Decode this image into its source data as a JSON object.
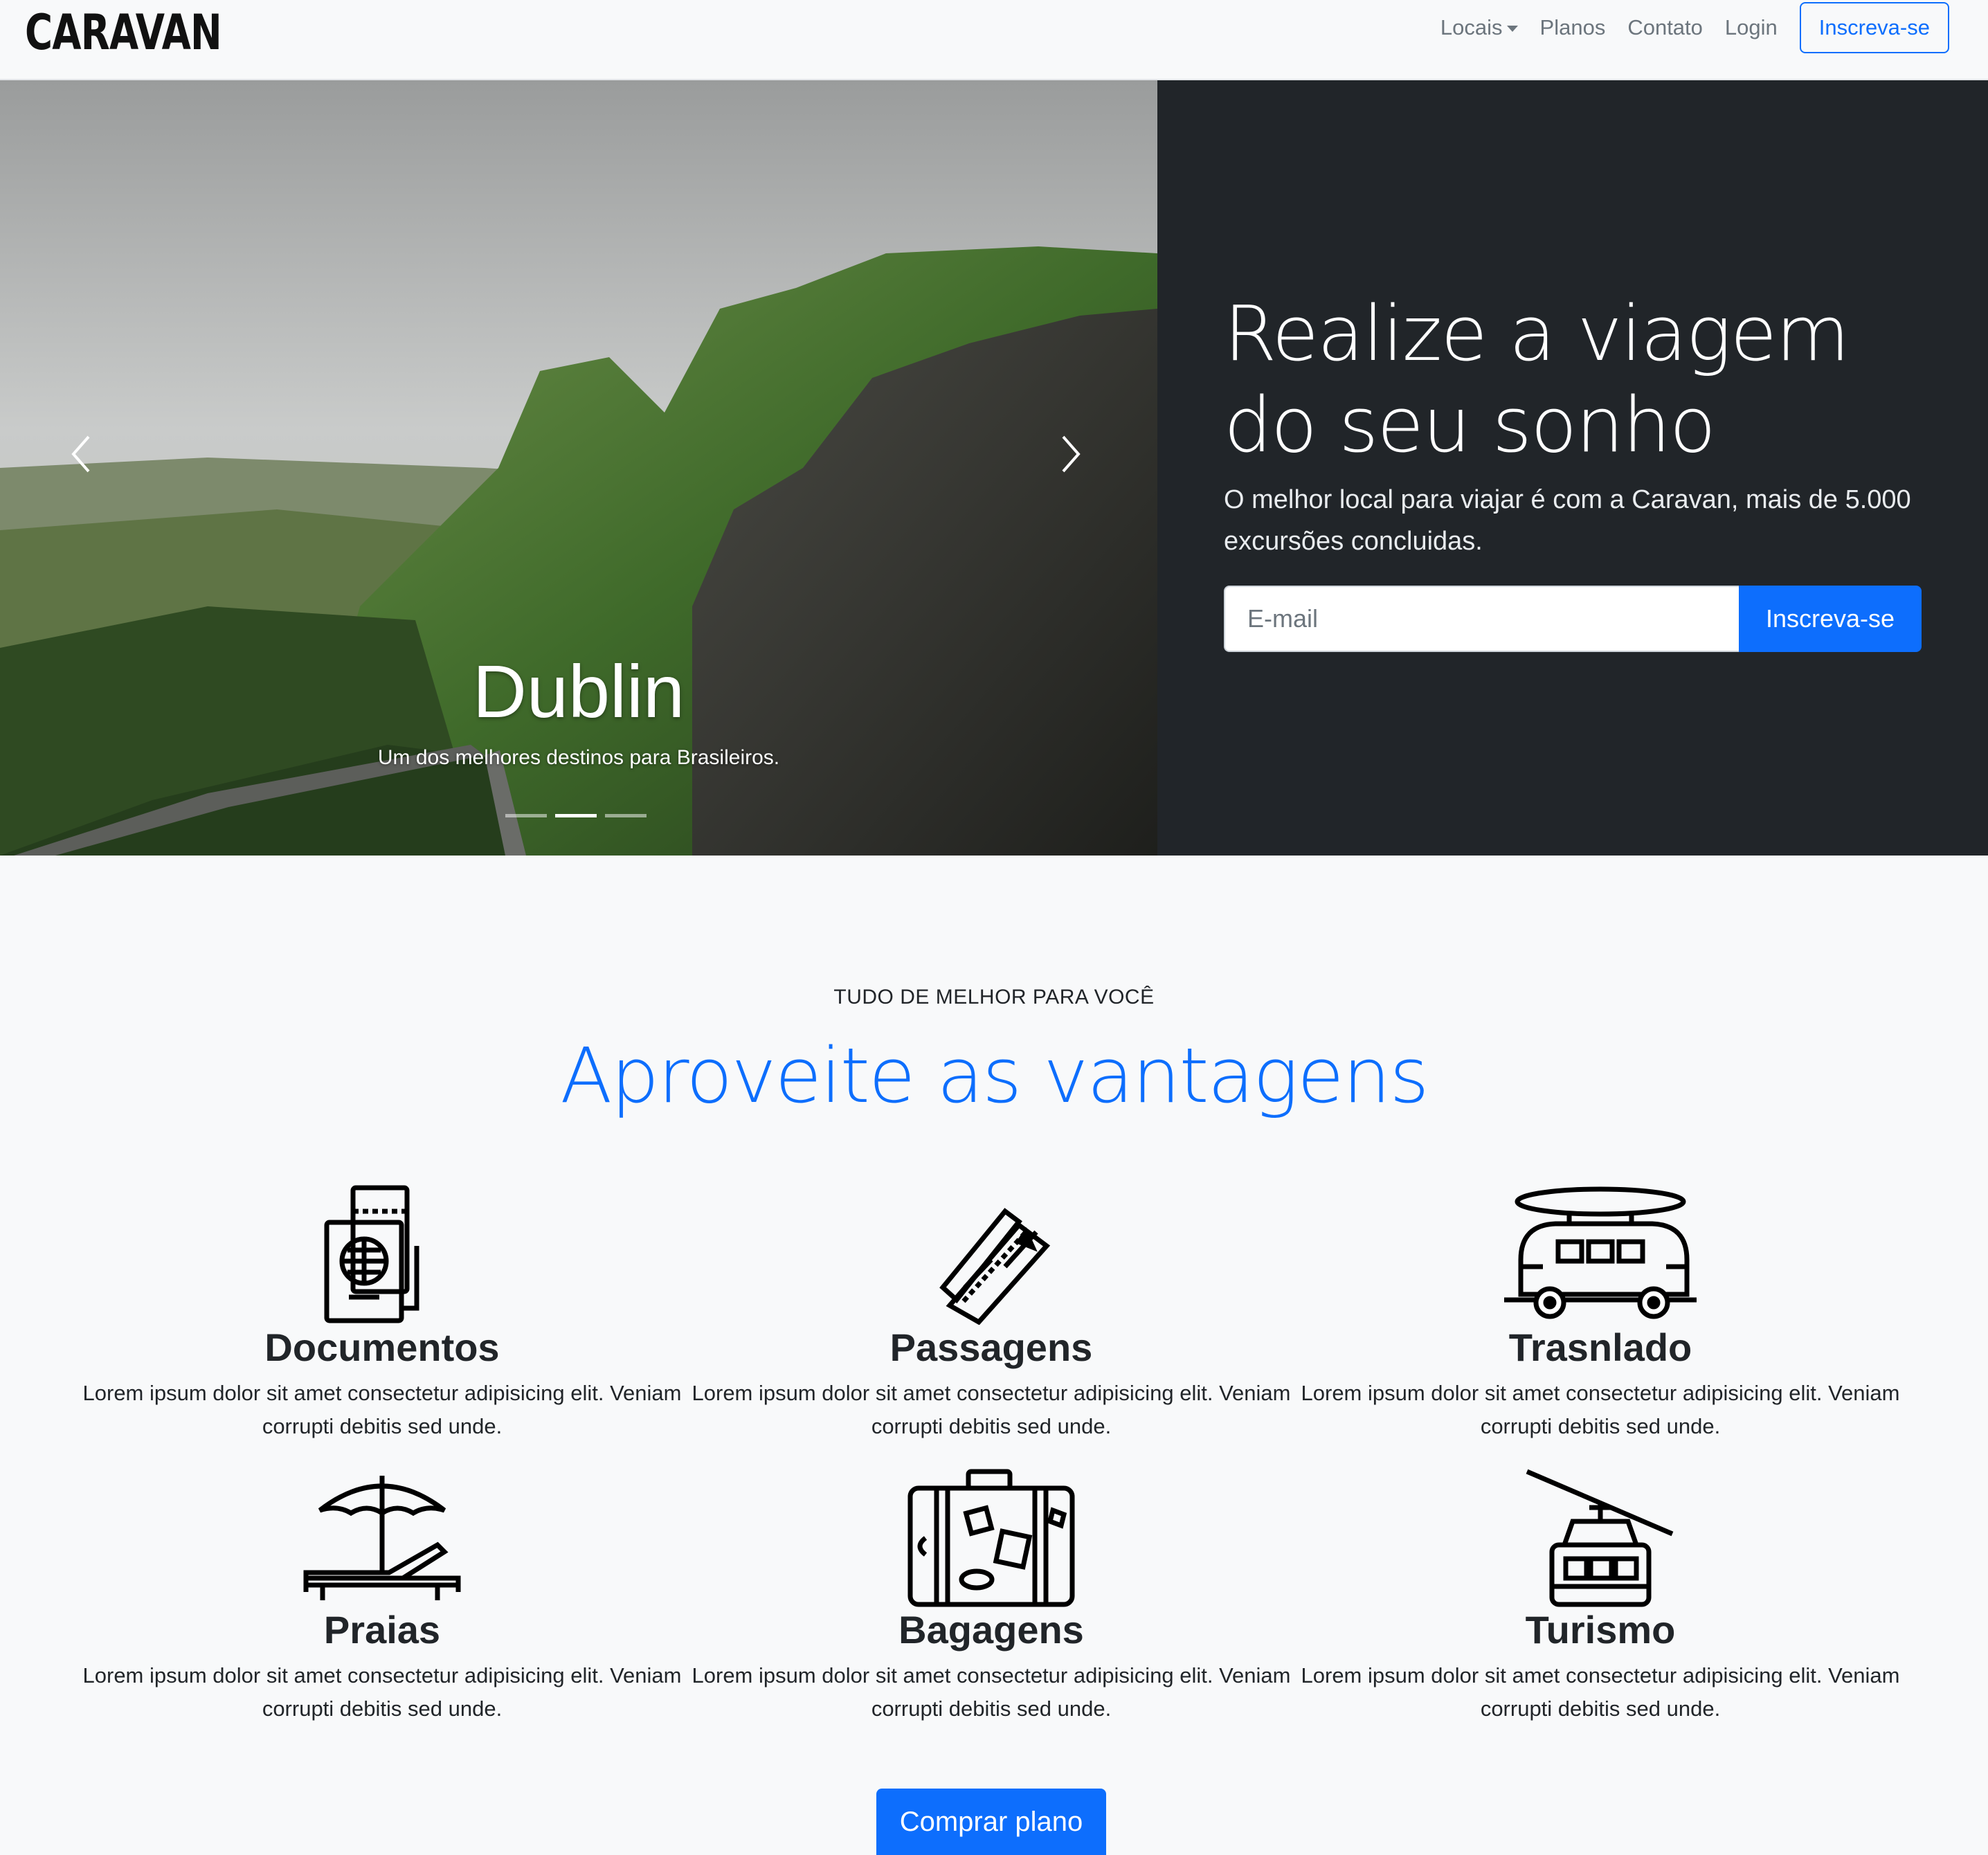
{
  "navbar": {
    "brand": "CARAVAN",
    "links": [
      "Locais",
      "Planos",
      "Contato",
      "Login"
    ],
    "cta": "Inscreva-se"
  },
  "carousel": {
    "caption_title": "Dublin",
    "caption_text": "Um dos melhores destinos para Brasileiros.",
    "active_slide": 2,
    "slide_count": 3
  },
  "hero": {
    "title": "Realize a viagem do seu sonho",
    "subtitle": "O melhor local para viajar é com a Caravan, mais de 5.000 excursões concluidas.",
    "email_placeholder": "E-mail",
    "signup_button": "Inscreva-se"
  },
  "features": {
    "eyebrow": "TUDO DE MELHOR PARA VOCÊ",
    "title": "Aproveite as vantagens",
    "items": [
      {
        "icon": "passport-icon",
        "title": "Documentos",
        "text": "Lorem ipsum dolor sit amet consectetur adipisicing elit. Veniam corrupti debitis sed unde."
      },
      {
        "icon": "ticket-icon",
        "title": "Passagens",
        "text": "Lorem ipsum dolor sit amet consectetur adipisicing elit. Veniam corrupti debitis sed unde."
      },
      {
        "icon": "van-icon",
        "title": "Trasnlado",
        "text": "Lorem ipsum dolor sit amet consectetur adipisicing elit. Veniam corrupti debitis sed unde."
      },
      {
        "icon": "beach-umbrella-icon",
        "title": "Praias",
        "text": "Lorem ipsum dolor sit amet consectetur adipisicing elit. Veniam corrupti debitis sed unde."
      },
      {
        "icon": "suitcase-icon",
        "title": "Bagagens",
        "text": "Lorem ipsum dolor sit amet consectetur adipisicing elit. Veniam corrupti debitis sed unde."
      },
      {
        "icon": "cable-car-icon",
        "title": "Turismo",
        "text": "Lorem ipsum dolor sit amet consectetur adipisicing elit. Veniam corrupti debitis sed unde."
      }
    ],
    "buy_button": "Comprar plano"
  },
  "colors": {
    "primary": "#0d6efd",
    "dark_panel": "#212529",
    "page_bg": "#f8f9fa"
  }
}
